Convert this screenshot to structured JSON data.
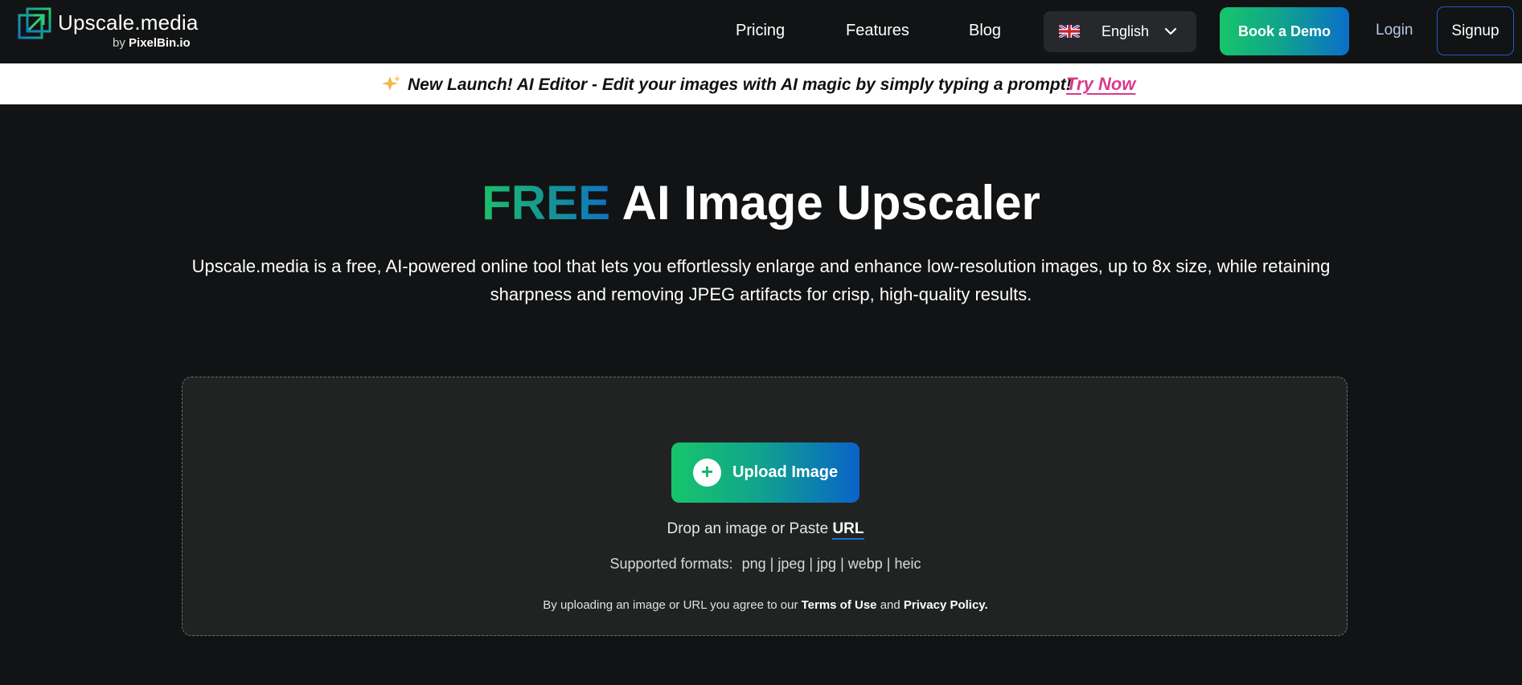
{
  "header": {
    "brand_name": "Upscale.media",
    "brand_by": "by",
    "brand_parent": "PixelBin.io",
    "nav": {
      "pricing": "Pricing",
      "features": "Features",
      "blog": "Blog"
    },
    "language": {
      "selected": "English",
      "flag_icon": "uk-flag-icon",
      "chevron_icon": "chevron-down-icon"
    },
    "book_demo": "Book a Demo",
    "login": "Login",
    "signup": "Signup"
  },
  "announcement": {
    "icon": "sparkle-icon",
    "text": "New Launch! AI Editor - Edit your images with AI magic by simply typing a prompt!",
    "cta": "Try Now"
  },
  "hero": {
    "title_highlight": "FREE",
    "title_rest": "AI Image Upscaler",
    "description": "Upscale.media is a free, AI-powered online tool that lets you effortlessly enlarge and enhance low-resolution images, up to 8x size, while retaining sharpness and removing JPEG artifacts for crisp, high-quality results."
  },
  "upload": {
    "button_label": "Upload Image",
    "plus_icon": "plus-icon",
    "drop_text": "Drop an image or Paste",
    "url_link": "URL",
    "formats_label": "Supported formats:",
    "formats_list": "png | jpeg | jpg | webp | heic",
    "terms_prefix": "By uploading an image or URL you agree to our",
    "terms_link": "Terms of Use",
    "terms_and": "and",
    "privacy_link": "Privacy Policy."
  },
  "colors": {
    "background": "#121314",
    "dropzone": "#212323",
    "gradient_green": "#17c56b",
    "gradient_blue": "#0a63c9",
    "accent_pink": "#d93a8c"
  }
}
